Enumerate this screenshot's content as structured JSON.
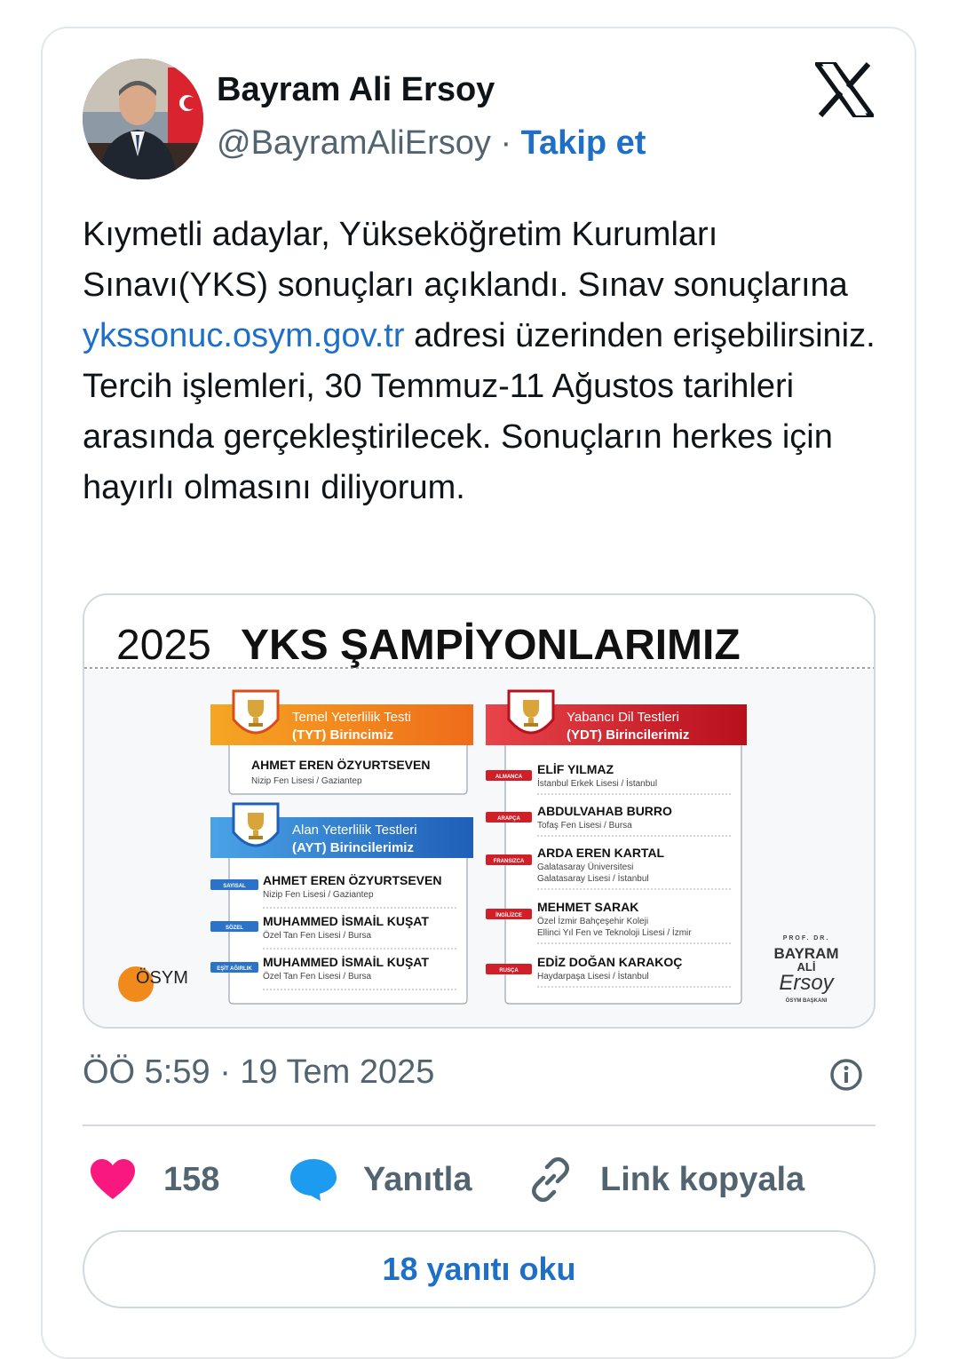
{
  "author": {
    "name": "Bayram Ali Ersoy",
    "handle": "@BayramAliErsoy",
    "separator": "·",
    "follow_label": "Takip et"
  },
  "tweet": {
    "text_before_link": "Kıymetli adaylar, Yükseköğretim Kurumları Sınavı(YKS) sonuçları açıklandı. Sınav sonuçlarına ",
    "link": "ykssonuc.osym.gov.tr",
    "text_after_link": " adresi üzerinden erişebilirsiniz. Tercih işlemleri, 30 Temmuz-11 Ağustos tarihleri arasında gerçekleştirilecek. Sonuçların herkes için hayırlı olmasını diliyorum."
  },
  "media": {
    "title_year": "2025",
    "title_main": "YKS ŞAMPİYONLARIMIZ",
    "tyt": {
      "header_line1": "Temel Yeterlilik Testi",
      "header_line2": "(TYT) Birincimiz",
      "name": "AHMET EREN ÖZYURTSEVEN",
      "school": "Nizip Fen Lisesi / Gaziantep"
    },
    "ayt": {
      "header_line1": "Alan Yeterlilik Testleri",
      "header_line2": "(AYT) Birincilerimiz",
      "rows": [
        {
          "tag": "SAYISAL",
          "name": "AHMET EREN ÖZYURTSEVEN",
          "school": "Nizip Fen Lisesi / Gaziantep"
        },
        {
          "tag": "SÖZEL",
          "name": "MUHAMMED İSMAİL KUŞAT",
          "school": "Özel Tan Fen Lisesi / Bursa"
        },
        {
          "tag": "EŞİT AĞIRLIK",
          "name": "MUHAMMED İSMAİL KUŞAT",
          "school": "Özel Tan Fen Lisesi / Bursa"
        }
      ]
    },
    "ydt": {
      "header_line1": "Yabancı Dil Testleri",
      "header_line2": "(YDT) Birincilerimiz",
      "rows": [
        {
          "tag": "ALMANCA",
          "name": "ELİF YILMAZ",
          "school1": "İstanbul Erkek Lisesi / İstanbul",
          "school2": ""
        },
        {
          "tag": "ARAPÇA",
          "name": "ABDULVAHAB BURRO",
          "school1": "Tofaş Fen Lisesi / Bursa",
          "school2": ""
        },
        {
          "tag": "FRANSIZCA",
          "name": "ARDA EREN KARTAL",
          "school1": "Galatasaray Üniversitesi",
          "school2": "Galatasaray Lisesi / İstanbul"
        },
        {
          "tag": "İNGİLİZCE",
          "name": "MEHMET SARAK",
          "school1": "Özel İzmir Bahçeşehir Koleji",
          "school2": "Ellinci Yıl Fen ve Teknoloji Lisesi / İzmir"
        },
        {
          "tag": "RUSÇA",
          "name": "EDİZ DOĞAN KARAKOÇ",
          "school1": "Haydarpaşa Lisesi / İstanbul",
          "school2": ""
        }
      ]
    },
    "osym_label": "ÖSYM",
    "signature": {
      "prefix": "PROF. DR.",
      "line1": "BAYRAM",
      "line2": "ALİ",
      "line3": "Ersoy",
      "caption": "ÖSYM BAŞKANI"
    }
  },
  "meta": {
    "timestamp": "ÖÖ 5:59 · 19 Tem 2025"
  },
  "actions": {
    "like_count": "158",
    "reply_label": "Yanıtla",
    "copy_link_label": "Link kopyala"
  },
  "read_replies_label": "18 yanıtı oku",
  "colors": {
    "link_blue": "#1d6fc7",
    "heart": "#f91880",
    "reply_bubble": "#1d9bf0",
    "tyt_orange": "#f07d1a",
    "ayt_blue": "#2a73c9",
    "ydt_red": "#d11f2a"
  },
  "icons": {
    "logo": "x-logo-icon",
    "info": "info-icon",
    "like": "heart-icon",
    "reply": "speech-bubble-icon",
    "copy": "link-icon",
    "trophy": "trophy-icon"
  }
}
